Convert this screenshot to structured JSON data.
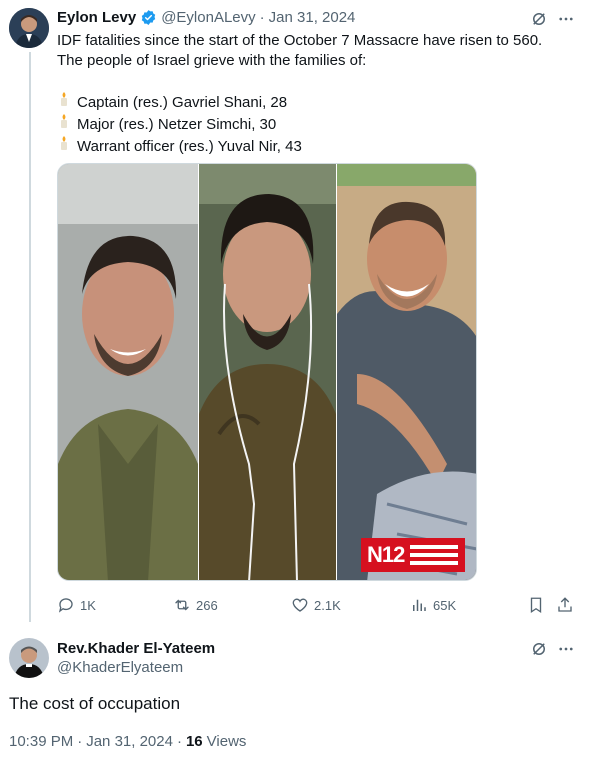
{
  "tweet": {
    "author_name": "Eylon Levy",
    "handle": "@EylonALevy",
    "separator": "·",
    "date": "Jan 31, 2024",
    "line1": "IDF fatalities since the start of the October 7 Massacre have risen to 560.",
    "line2": "The people of Israel grieve with the families of:",
    "names": [
      "Captain (res.) Gavriel Shani, 28",
      "Major (res.) Netzer Simchi, 30",
      "Warrant officer (res.) Yuval Nir, 43"
    ],
    "logo_text": "N12",
    "actions": {
      "replies": "1K",
      "reposts": "266",
      "likes": "2.1K",
      "views": "65K"
    }
  },
  "reply": {
    "author_name": "Rev.Khader El-Yateem",
    "handle": "@KhaderElyateem",
    "text": "The cost of occupation",
    "time": "10:39 PM",
    "separator": "·",
    "date": "Jan 31, 2024",
    "separator2": "·",
    "views_count": "16",
    "views_label": "Views"
  },
  "colors": {
    "verified": "#1d9bf0",
    "text": "#0f1419",
    "muted": "#536471",
    "logo_red": "#d6101f"
  }
}
